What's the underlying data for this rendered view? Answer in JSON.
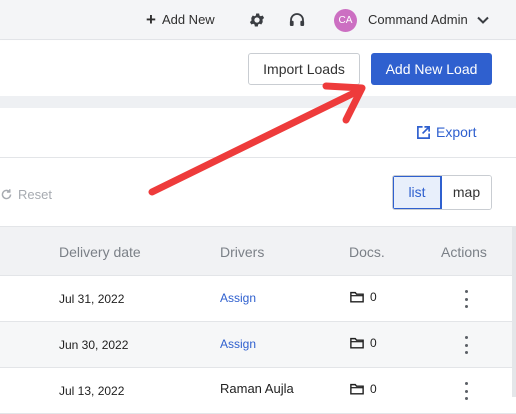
{
  "topbar": {
    "add_new_label": "Add New",
    "user_initials": "CA",
    "user_name": "Command Admin"
  },
  "actions": {
    "import_label": "Import Loads",
    "add_load_label": "Add New Load"
  },
  "toolbar": {
    "export_label": "Export",
    "reset_label": "Reset",
    "view_list_label": "list",
    "view_map_label": "map",
    "active_view": "list"
  },
  "table": {
    "headers": {
      "delivery_date": "Delivery date",
      "drivers": "Drivers",
      "docs": "Docs.",
      "actions": "Actions"
    },
    "rows": [
      {
        "delivery_date": "Jul 31, 2022",
        "driver": "Assign",
        "driver_is_link": true,
        "docs_count": "0"
      },
      {
        "delivery_date": "Jun 30, 2022",
        "driver": "Assign",
        "driver_is_link": true,
        "docs_count": "0"
      },
      {
        "delivery_date": "Jul 13, 2022",
        "driver": "Raman Aujla",
        "driver_is_link": false,
        "docs_count": "0"
      }
    ]
  },
  "colors": {
    "primary": "#2f60cf",
    "avatar": "#cc6fc2",
    "annotation_arrow": "#ee3b3b"
  },
  "icons": [
    "plus-icon",
    "gear-icon",
    "headset-icon",
    "chevron-down-icon",
    "export-icon",
    "reset-icon",
    "folder-icon",
    "kebab-menu-icon",
    "annotation-arrow"
  ]
}
